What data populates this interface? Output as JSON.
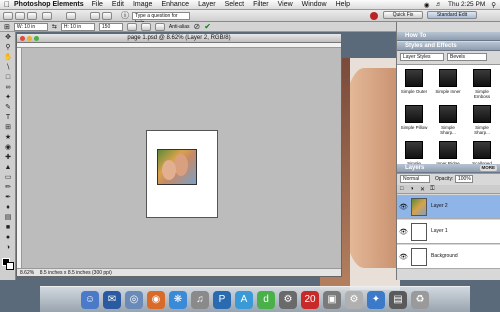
{
  "menubar": {
    "app_name": "Photoshop Elements",
    "items": [
      "File",
      "Edit",
      "Image",
      "Enhance",
      "Layer",
      "Select",
      "Filter",
      "View",
      "Window",
      "Help"
    ],
    "clock": "Thu 2:25 PM"
  },
  "options": {
    "search_placeholder": "Type a question for help",
    "quick_fix_label": "Quick Fix",
    "standard_edit_label": "Standard Edit",
    "width_value": "W: 10 in",
    "height_value": "H: 10 in",
    "resolution_value": "150",
    "antialias_label": "Anti-alias"
  },
  "document": {
    "title": "page 1.psd @ 8.62% (Layer 2, RGB/8)",
    "zoom": "8.62%",
    "size_info": "8.5 inches x 8.5 inches (300 ppi)"
  },
  "panels": {
    "how_to_title": "How To",
    "styles_title": "Styles and Effects",
    "styles_category": "Layer Styles",
    "styles_subcategory": "Bevels",
    "effects": [
      "Simple Outer",
      "Simple Inner",
      "Simple Emboss",
      "Simple Pillow",
      "Simple Sharp...",
      "Simple Sharp...",
      "Simple Sharp...",
      "Inner Ridge",
      "Scalloped Edge"
    ],
    "layers_title": "Layers",
    "more_label": "MORE",
    "blend_mode": "Normal",
    "opacity_label": "Opacity:",
    "opacity_value": "100%",
    "layers": [
      "Layer 2",
      "Layer 1",
      "Background"
    ]
  },
  "colors": {
    "panel_header": "#8e9db0",
    "selected_layer": "#8eb4e8",
    "effect_swatch": "#222222"
  }
}
